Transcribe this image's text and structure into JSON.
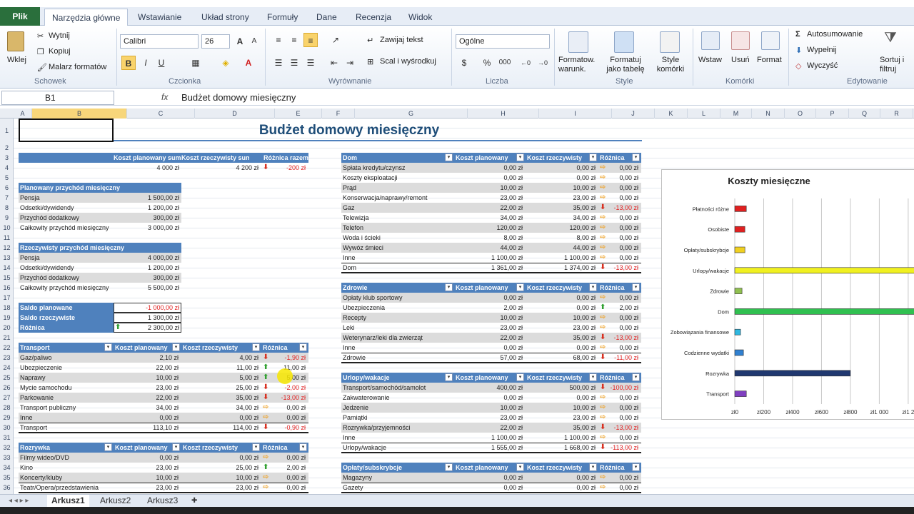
{
  "ribbon_tabs": [
    "Plik",
    "Narzędzia główne",
    "Wstawianie",
    "Układ strony",
    "Formuły",
    "Dane",
    "Recenzja",
    "Widok"
  ],
  "clipboard": {
    "paste": "Wklej",
    "cut": "Wytnij",
    "copy": "Kopiuj",
    "painter": "Malarz formatów",
    "label": "Schowek"
  },
  "font": {
    "name": "Calibri",
    "size": "26",
    "label": "Czcionka",
    "bold": "B",
    "italic": "I",
    "underline": "U"
  },
  "alignment": {
    "wrap": "Zawijaj tekst",
    "merge": "Scal i wyśrodkuj",
    "label": "Wyrównanie"
  },
  "number": {
    "format": "Ogólne",
    "label": "Liczba",
    "percent": "%",
    "thousands": "000"
  },
  "styles": {
    "conditional": "Formatow. warunk.",
    "as_table": "Formatuj jako tabelę",
    "cell_styles": "Style komórki",
    "label": "Style"
  },
  "cells": {
    "insert": "Wstaw",
    "delete": "Usuń",
    "format": "Format",
    "label": "Komórki"
  },
  "editing": {
    "autosum": "Autosumowanie",
    "fill": "Wypełnij",
    "clear": "Wyczyść",
    "sort": "Sortuj i filtruj",
    "label": "Edytowanie"
  },
  "formula_bar": {
    "cell_ref": "B1",
    "fx": "fx",
    "content": "Budżet domowy miesięczny"
  },
  "columns": [
    "A",
    "B",
    "C",
    "D",
    "E",
    "F",
    "G",
    "H",
    "I",
    "J",
    "K",
    "L",
    "M",
    "N",
    "O",
    "P",
    "Q",
    "R"
  ],
  "rows": [
    "1",
    "2",
    "3",
    "4",
    "5",
    "6",
    "7",
    "8",
    "9",
    "10",
    "11",
    "12",
    "13",
    "14",
    "15",
    "16",
    "17",
    "18",
    "19",
    "20",
    "21",
    "22",
    "23",
    "24",
    "25",
    "26",
    "27",
    "28",
    "29",
    "30",
    "31",
    "32",
    "33",
    "34",
    "35",
    "36"
  ],
  "title": "Budżet domowy miesięczny",
  "summary": {
    "headers": [
      "Koszt planowany suma",
      "Koszt rzeczywisty suma",
      "Różnica razem"
    ],
    "values": [
      "4 000 zł",
      "4 200 zł",
      "-200 zł"
    ]
  },
  "planned_income": {
    "title": "Planowany przychód miesięczny",
    "rows": [
      [
        "Pensja",
        "1 500,00 zł"
      ],
      [
        "Odsetki/dywidendy",
        "1 200,00 zł"
      ],
      [
        "Przychód dodatkowy",
        "300,00 zł"
      ],
      [
        "Całkowity przychód miesięczny",
        "3 000,00 zł"
      ]
    ]
  },
  "actual_income": {
    "title": "Rzeczywisty przychód miesięczny",
    "rows": [
      [
        "Pensja",
        "4 000,00 zł"
      ],
      [
        "Odsetki/dywidendy",
        "1 200,00 zł"
      ],
      [
        "Przychód dodatkowy",
        "300,00 zł"
      ],
      [
        "Całkowity przychód miesięczny",
        "5 500,00 zł"
      ]
    ]
  },
  "balance": {
    "rows": [
      [
        "Saldo planowane",
        "-1 000,00 zł"
      ],
      [
        "Saldo rzeczywiste",
        "1 300,00 zł"
      ],
      [
        "Różnica",
        "2 300,00 zł"
      ]
    ]
  },
  "table_headers": [
    "Koszt planowany",
    "Koszt rzeczywisty",
    "Różnica"
  ],
  "transport": {
    "title": "Transport",
    "rows": [
      [
        "Gaz/paliwo",
        "2,10 zł",
        "4,00 zł",
        "-1,90 zł",
        "down"
      ],
      [
        "Ubezpieczenie",
        "22,00 zł",
        "11,00 zł",
        "11,00 zł",
        "up"
      ],
      [
        "Naprawy",
        "10,00 zł",
        "5,00 zł",
        "5,00 zł",
        "up"
      ],
      [
        "Mycie samochodu",
        "23,00 zł",
        "25,00 zł",
        "-2,00 zł",
        "down"
      ],
      [
        "Parkowanie",
        "22,00 zł",
        "35,00 zł",
        "-13,00 zł",
        "down"
      ],
      [
        "Transport publiczny",
        "34,00 zł",
        "34,00 zł",
        "0,00 zł",
        "right"
      ],
      [
        "Inne",
        "0,00 zł",
        "0,00 zł",
        "0,00 zł",
        "right"
      ],
      [
        "Transport",
        "113,10 zł",
        "114,00 zł",
        "-0,90 zł",
        "down"
      ]
    ]
  },
  "entertainment": {
    "title": "Rozrywka",
    "rows": [
      [
        "Filmy wideo/DVD",
        "0,00 zł",
        "0,00 zł",
        "0,00 zł",
        "right"
      ],
      [
        "Kino",
        "23,00 zł",
        "25,00 zł",
        "2,00 zł",
        "up"
      ],
      [
        "Koncerty/kluby",
        "10,00 zł",
        "10,00 zł",
        "0,00 zł",
        "right"
      ],
      [
        "Teatr/Opera/przedstawienia",
        "23,00 zł",
        "23,00 zł",
        "0,00 zł",
        "right"
      ]
    ]
  },
  "home": {
    "title": "Dom",
    "rows": [
      [
        "Spłata kredytu/czynsz",
        "0,00 zł",
        "0,00 zł",
        "0,00 zł",
        "right"
      ],
      [
        "Koszty eksploatacji",
        "0,00 zł",
        "0,00 zł",
        "0,00 zł",
        "right"
      ],
      [
        "Prąd",
        "10,00 zł",
        "10,00 zł",
        "0,00 zł",
        "right"
      ],
      [
        "Konserwacja/naprawy/remont",
        "23,00 zł",
        "23,00 zł",
        "0,00 zł",
        "right"
      ],
      [
        "Gaz",
        "22,00 zł",
        "35,00 zł",
        "-13,00 zł",
        "down"
      ],
      [
        "Telewizja",
        "34,00 zł",
        "34,00 zł",
        "0,00 zł",
        "right"
      ],
      [
        "Telefon",
        "120,00 zł",
        "120,00 zł",
        "0,00 zł",
        "right"
      ],
      [
        "Woda i ścieki",
        "8,00 zł",
        "8,00 zł",
        "0,00 zł",
        "right"
      ],
      [
        "Wywóz śmieci",
        "44,00 zł",
        "44,00 zł",
        "0,00 zł",
        "right"
      ],
      [
        "Inne",
        "1 100,00 zł",
        "1 100,00 zł",
        "0,00 zł",
        "right"
      ],
      [
        "Dom",
        "1 361,00 zł",
        "1 374,00 zł",
        "-13,00 zł",
        "down"
      ]
    ]
  },
  "health": {
    "title": "Zdrowie",
    "rows": [
      [
        "Opłaty klub sportowy",
        "0,00 zł",
        "0,00 zł",
        "0,00 zł",
        "right"
      ],
      [
        "Ubezpieczenia",
        "2,00 zł",
        "0,00 zł",
        "2,00 zł",
        "up"
      ],
      [
        "Recepty",
        "10,00 zł",
        "10,00 zł",
        "0,00 zł",
        "right"
      ],
      [
        "Leki",
        "23,00 zł",
        "23,00 zł",
        "0,00 zł",
        "right"
      ],
      [
        "Weterynarz/leki dla zwierząt",
        "22,00 zł",
        "35,00 zł",
        "-13,00 zł",
        "down"
      ],
      [
        "Inne",
        "0,00 zł",
        "0,00 zł",
        "0,00 zł",
        "right"
      ],
      [
        "Zdrowie",
        "57,00 zł",
        "68,00 zł",
        "-11,00 zł",
        "down"
      ]
    ]
  },
  "vacation": {
    "title": "Urlopy/wakacje",
    "rows": [
      [
        "Transport/samochód/samolot",
        "400,00 zł",
        "500,00 zł",
        "-100,00 zł",
        "down"
      ],
      [
        "Zakwaterowanie",
        "0,00 zł",
        "0,00 zł",
        "0,00 zł",
        "right"
      ],
      [
        "Jedzenie",
        "10,00 zł",
        "10,00 zł",
        "0,00 zł",
        "right"
      ],
      [
        "Pamiątki",
        "23,00 zł",
        "23,00 zł",
        "0,00 zł",
        "right"
      ],
      [
        "Rozrywka/przyjemności",
        "22,00 zł",
        "35,00 zł",
        "-13,00 zł",
        "down"
      ],
      [
        "Inne",
        "1 100,00 zł",
        "1 100,00 zł",
        "0,00 zł",
        "right"
      ],
      [
        "Urlopy/wakacje",
        "1 555,00 zł",
        "1 668,00 zł",
        "-113,00 zł",
        "down"
      ]
    ]
  },
  "subscriptions": {
    "title": "Opłaty/subskrybcje",
    "rows": [
      [
        "Magazyny",
        "0,00 zł",
        "0,00 zł",
        "0,00 zł",
        "right"
      ],
      [
        "Gazety",
        "0,00 zł",
        "0,00 zł",
        "0,00 zł",
        "right"
      ]
    ]
  },
  "chart_data": {
    "type": "bar",
    "orientation": "horizontal",
    "title": "Koszty miesięczne",
    "categories": [
      "Płatności różne",
      "Osobiste",
      "Opłaty/subskrybcje",
      "Urlopy/wakacje",
      "Zdrowie",
      "Dom",
      "Zobowiązania finansowe",
      "Codzienne wydatki",
      "Rozrywka",
      "Transport"
    ],
    "values": [
      80,
      70,
      70,
      1668,
      50,
      1374,
      40,
      60,
      800,
      80
    ],
    "colors": [
      "#e02020",
      "#e02020",
      "#f0d020",
      "#f0f020",
      "#90c050",
      "#30c050",
      "#30b8e0",
      "#3080d0",
      "#203870",
      "#8040c0"
    ],
    "x_ticks": [
      "zł0",
      "zł200",
      "zł400",
      "zł600",
      "zł800",
      "zł1 000",
      "zł1 2"
    ],
    "xlim": [
      0,
      1200
    ],
    "grid": true
  },
  "sheet_tabs": [
    "Arkusz1",
    "Arkusz2",
    "Arkusz3"
  ]
}
